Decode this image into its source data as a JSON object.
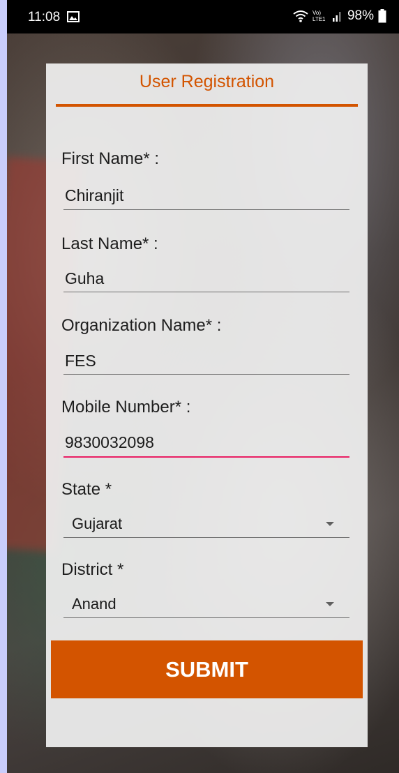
{
  "status_bar": {
    "time": "11:08",
    "network_label": "Vo) LTE1",
    "battery": "98%"
  },
  "form": {
    "title": "User Registration",
    "first_name_label": "First Name* :",
    "first_name_value": "Chiranjit",
    "last_name_label": "Last Name* :",
    "last_name_value": "Guha",
    "organization_label": "Organization Name* :",
    "organization_value": "FES",
    "mobile_label": "Mobile Number* :",
    "mobile_value": "9830032098",
    "state_label": "State *",
    "state_value": "Gujarat",
    "district_label": "District *",
    "district_value": "Anand",
    "submit_label": "SUBMIT"
  },
  "colors": {
    "accent": "#d35400",
    "focus_underline": "#e91e63"
  },
  "icons": [
    "gallery-icon",
    "wifi-icon",
    "signal-icon",
    "battery-icon",
    "dropdown-arrow-icon"
  ]
}
